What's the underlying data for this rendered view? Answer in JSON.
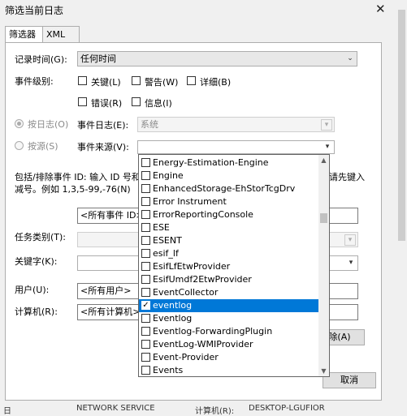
{
  "window": {
    "title": "筛选当前日志",
    "close": "✕"
  },
  "tabs": [
    {
      "label": "筛选器"
    },
    {
      "label": "XML"
    }
  ],
  "filter": {
    "logged_label": "记录时间(G):",
    "logged_value": "任何时间",
    "level_label": "事件级别:",
    "levels": [
      {
        "label": "关键(L)",
        "checked": false
      },
      {
        "label": "警告(W)",
        "checked": false
      },
      {
        "label": "详细(B)",
        "checked": false
      },
      {
        "label": "错误(R)",
        "checked": false
      },
      {
        "label": "信息(I)",
        "checked": false
      }
    ],
    "by_log_label": "按日志(O)",
    "event_logs_label": "事件日志(E):",
    "event_logs_value": "系统",
    "by_source_label": "按源(S)",
    "event_sources_label": "事件来源(V):",
    "include_line1": "包括/排除事件 ID: 输入 ID 号和",
    "include_line1_right": "请先键入",
    "include_line2": "减号。例如 1,3,5-99,-76(N)",
    "event_ids_value": "<所有事件 ID>",
    "task_category_label": "任务类别(T):",
    "keywords_label": "关键字(K):",
    "user_label": "用户(U):",
    "user_value": "<所有用户>",
    "computer_label": "计算机(R):",
    "computer_value": "<所有计算机>",
    "clear_button": "除(A)",
    "cancel_button": "取消"
  },
  "dropdown": {
    "items": [
      {
        "label": "Energy-Estimation-Engine",
        "checked": false
      },
      {
        "label": "Engine",
        "checked": false
      },
      {
        "label": "EnhancedStorage-EhStorTcgDrv",
        "checked": false
      },
      {
        "label": "Error Instrument",
        "checked": false
      },
      {
        "label": "ErrorReportingConsole",
        "checked": false
      },
      {
        "label": "ESE",
        "checked": false
      },
      {
        "label": "ESENT",
        "checked": false
      },
      {
        "label": "esif_lf",
        "checked": false
      },
      {
        "label": "EsifLfEtwProvider",
        "checked": false
      },
      {
        "label": "EsifUmdf2EtwProvider",
        "checked": false
      },
      {
        "label": "EventCollector",
        "checked": false
      },
      {
        "label": "eventlog",
        "checked": true,
        "selected": true
      },
      {
        "label": "Eventlog",
        "checked": false
      },
      {
        "label": "Eventlog-ForwardingPlugin",
        "checked": false
      },
      {
        "label": "EventLog-WMIProvider",
        "checked": false
      },
      {
        "label": "Event-Provider",
        "checked": false
      },
      {
        "label": "Events",
        "checked": false
      }
    ]
  },
  "background_row": {
    "c1": "日",
    "c2": "NETWORK SERVICE",
    "c3": "计算机(R):",
    "c4": "DESKTOP-LGUFIOR"
  },
  "colors": {
    "selection": "#0078d7"
  }
}
